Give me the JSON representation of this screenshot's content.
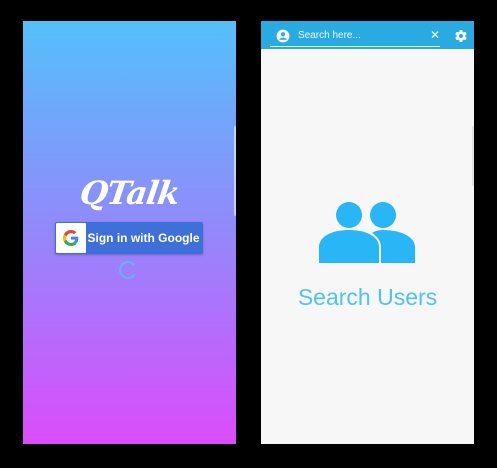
{
  "login": {
    "app_name": "QTalk",
    "google_button_label": "Sign in with Google",
    "google_logo_letter": "G",
    "loading": true
  },
  "search": {
    "search_placeholder": "Search here...",
    "clear_icon": "close-icon",
    "settings_icon": "gear-icon",
    "profile_icon": "account-circle-icon",
    "empty_state_icon": "group-icon",
    "empty_state_title": "Search Users"
  },
  "colors": {
    "login_gradient_top": "#54c0fb",
    "login_gradient_bottom": "#dc4cfb",
    "google_button": "#3f6fd8",
    "app_bar": "#29abe2",
    "accent": "#4fc3f7"
  }
}
